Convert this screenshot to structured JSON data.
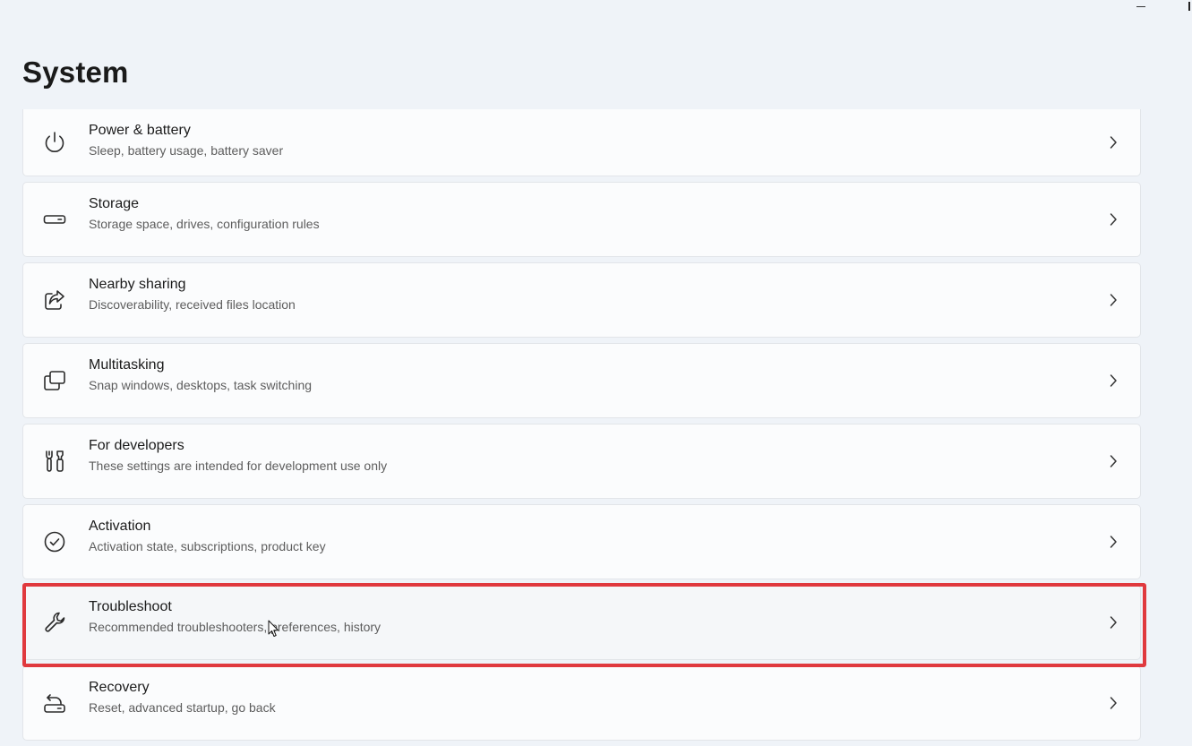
{
  "page": {
    "title": "System"
  },
  "colors": {
    "background": "#eff3f8",
    "card": "#fbfcfd",
    "highlight": "#e0393e",
    "subtitle": "#5d5d5d"
  },
  "settings": {
    "items": [
      {
        "id": "power",
        "icon": "power-icon",
        "title": "Power & battery",
        "subtitle": "Sleep, battery usage, battery saver"
      },
      {
        "id": "storage",
        "icon": "storage-drive-icon",
        "title": "Storage",
        "subtitle": "Storage space, drives, configuration rules"
      },
      {
        "id": "nearby-sharing",
        "icon": "share-icon",
        "title": "Nearby sharing",
        "subtitle": "Discoverability, received files location"
      },
      {
        "id": "multitasking",
        "icon": "multitasking-windows-icon",
        "title": "Multitasking",
        "subtitle": "Snap windows, desktops, task switching"
      },
      {
        "id": "developers",
        "icon": "developer-tools-icon",
        "title": "For developers",
        "subtitle": "These settings are intended for development use only"
      },
      {
        "id": "activation",
        "icon": "checkmark-circle-icon",
        "title": "Activation",
        "subtitle": "Activation state, subscriptions, product key"
      },
      {
        "id": "troubleshoot",
        "icon": "wrench-icon",
        "title": "Troubleshoot",
        "subtitle": "Recommended troubleshooters, preferences, history",
        "selected": true
      },
      {
        "id": "recovery",
        "icon": "recovery-icon",
        "title": "Recovery",
        "subtitle": "Reset, advanced startup, go back"
      }
    ]
  }
}
